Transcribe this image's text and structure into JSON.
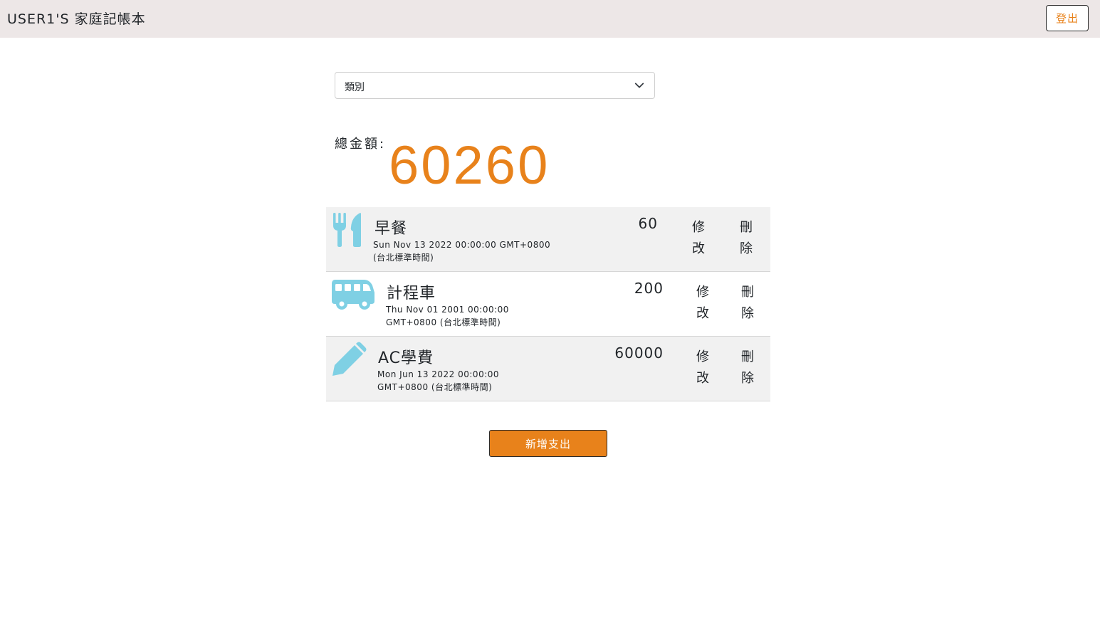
{
  "navbar": {
    "brand": "USER1'S 家庭記帳本",
    "logout_label": "登出"
  },
  "filter": {
    "category_selected": "類別"
  },
  "summary": {
    "total_label": "總金額:",
    "total_value": "60260"
  },
  "records": [
    {
      "icon": "utensils-icon",
      "name": "早餐",
      "date_line1": "Sun Nov 13 2022 00:00:00 GMT+0800",
      "date_line2": "(台北標準時間)",
      "amount": "60",
      "edit_label_1": "修",
      "edit_label_2": "改",
      "delete_label_1": "刪",
      "delete_label_2": "除"
    },
    {
      "icon": "bus-icon",
      "name": "計程車",
      "date_line1": "Thu Nov 01 2001 00:00:00",
      "date_line2": "GMT+0800 (台北標準時間)",
      "amount": "200",
      "edit_label_1": "修",
      "edit_label_2": "改",
      "delete_label_1": "刪",
      "delete_label_2": "除"
    },
    {
      "icon": "pencil-icon",
      "name": "AC學費",
      "date_line1": "Mon Jun 13 2022 00:00:00",
      "date_line2": "GMT+0800 (台北標準時間)",
      "amount": "60000",
      "edit_label_1": "修",
      "edit_label_2": "改",
      "delete_label_1": "刪",
      "delete_label_2": "除"
    }
  ],
  "actions": {
    "add_expense_label": "新增支出"
  },
  "colors": {
    "accent": "#e8821b",
    "icon": "#7fd0e4",
    "navbar_bg": "#ede7e7",
    "row_gray": "#f1f1f1"
  }
}
